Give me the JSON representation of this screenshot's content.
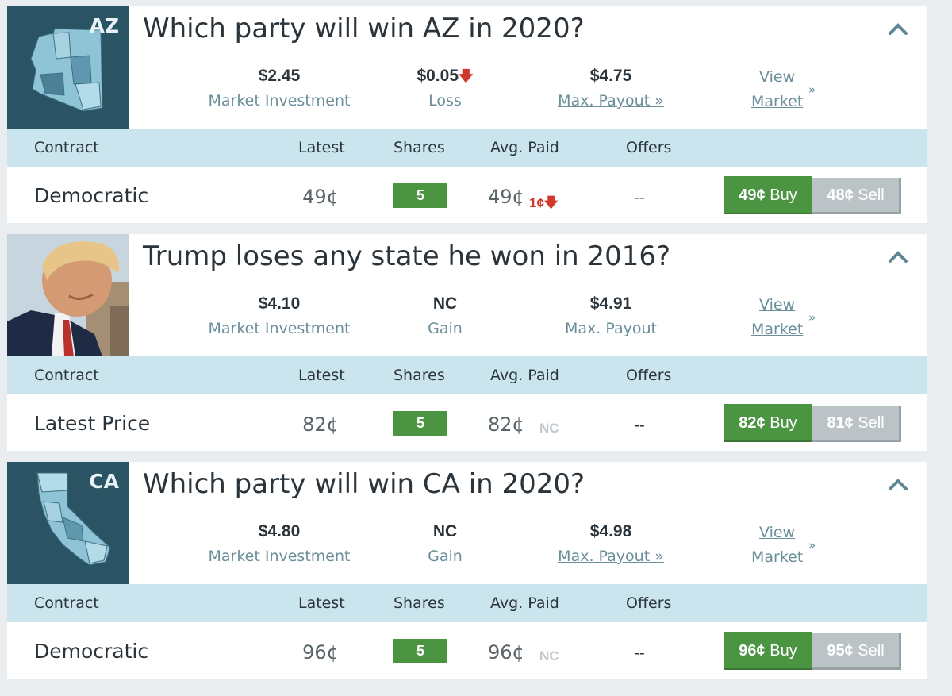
{
  "colors": {
    "page_bg": "#e9edf0",
    "header_bg": "#cbe5ee",
    "buy_green": "#4b9442",
    "sell_gray": "#bcc3c6",
    "loss_red": "#d0382b",
    "label_teal": "#6a8e9a"
  },
  "markets": [
    {
      "image": {
        "type": "state-map",
        "abbr": "AZ",
        "icon": "arizona-map-icon"
      },
      "title": "Which party will win AZ in 2020?",
      "investment": {
        "value": "$2.45",
        "label": "Market Investment"
      },
      "gain_loss": {
        "value": "$0.05",
        "label": "Loss",
        "direction": "down"
      },
      "payout": {
        "value": "$4.75",
        "label": "Max. Payout »"
      },
      "view_market": {
        "line1": "View",
        "line2": "Market",
        "chevron": "»"
      },
      "headers": {
        "contract": "Contract",
        "latest": "Latest",
        "shares": "Shares",
        "avg_paid": "Avg. Paid",
        "offers": "Offers"
      },
      "row": {
        "contract": "Democratic",
        "latest": "49¢",
        "shares": "5",
        "avg_paid": "49¢",
        "change": "1¢",
        "change_dir": "down",
        "offers": "--",
        "buy_price": "49¢",
        "buy_label": "Buy",
        "sell_price": "48¢",
        "sell_label": "Sell"
      }
    },
    {
      "image": {
        "type": "photo",
        "icon": "candidate-photo"
      },
      "title": "Trump loses any state he won in 2016?",
      "investment": {
        "value": "$4.10",
        "label": "Market Investment"
      },
      "gain_loss": {
        "value": "NC",
        "label": "Gain",
        "direction": "none"
      },
      "payout": {
        "value": "$4.91",
        "label": "Max. Payout"
      },
      "view_market": {
        "line1": "View",
        "line2": "Market",
        "chevron": "»"
      },
      "headers": {
        "contract": "Contract",
        "latest": "Latest",
        "shares": "Shares",
        "avg_paid": "Avg. Paid",
        "offers": "Offers"
      },
      "row": {
        "contract": "Latest Price",
        "latest": "82¢",
        "shares": "5",
        "avg_paid": "82¢",
        "change": "NC",
        "change_dir": "none",
        "offers": "--",
        "buy_price": "82¢",
        "buy_label": "Buy",
        "sell_price": "81¢",
        "sell_label": "Sell"
      }
    },
    {
      "image": {
        "type": "state-map",
        "abbr": "CA",
        "icon": "california-map-icon"
      },
      "title": "Which party will win CA in 2020?",
      "investment": {
        "value": "$4.80",
        "label": "Market Investment"
      },
      "gain_loss": {
        "value": "NC",
        "label": "Gain",
        "direction": "none"
      },
      "payout": {
        "value": "$4.98",
        "label": "Max. Payout »"
      },
      "view_market": {
        "line1": "View",
        "line2": "Market",
        "chevron": "»"
      },
      "headers": {
        "contract": "Contract",
        "latest": "Latest",
        "shares": "Shares",
        "avg_paid": "Avg. Paid",
        "offers": "Offers"
      },
      "row": {
        "contract": "Democratic",
        "latest": "96¢",
        "shares": "5",
        "avg_paid": "96¢",
        "change": "NC",
        "change_dir": "none",
        "offers": "--",
        "buy_price": "96¢",
        "buy_label": "Buy",
        "sell_price": "95¢",
        "sell_label": "Sell"
      }
    }
  ]
}
